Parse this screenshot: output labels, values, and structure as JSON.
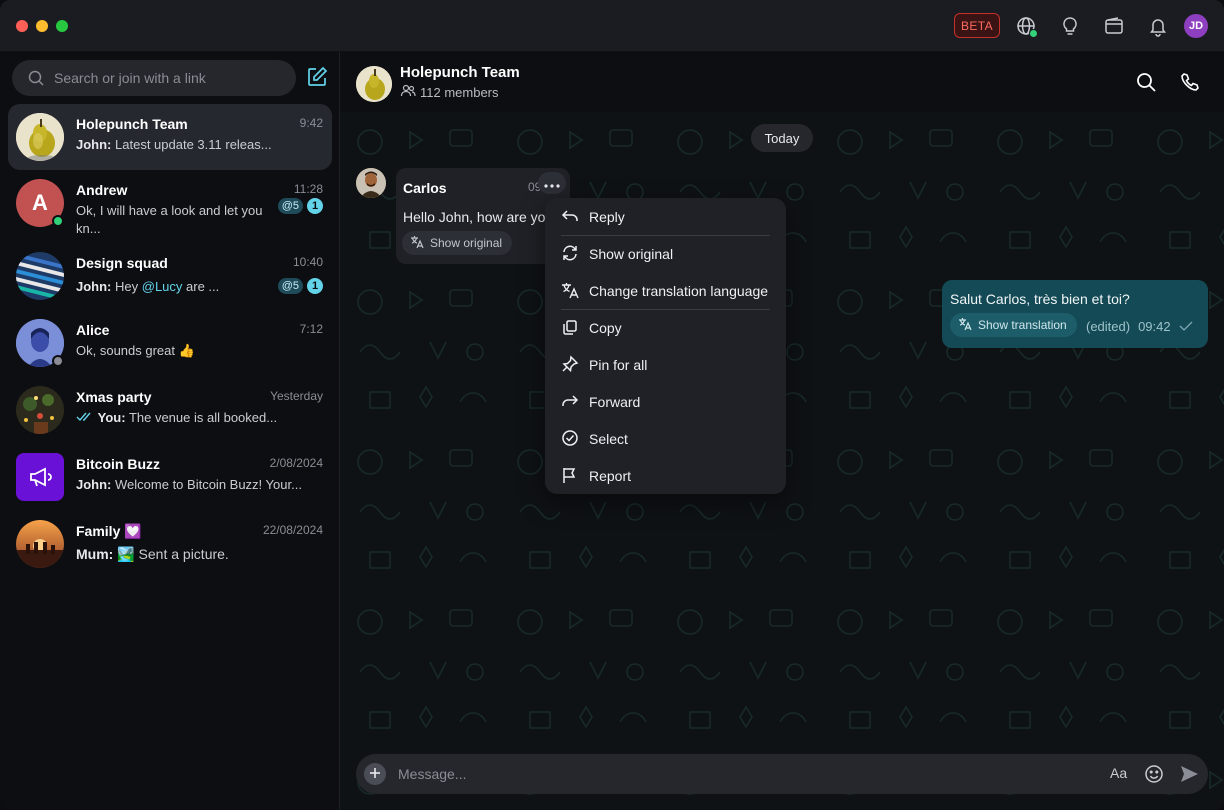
{
  "titlebar": {
    "beta_label": "BETA",
    "user_initials": "JD",
    "colors": {
      "close": "#ff5f57",
      "minimize": "#febc2e",
      "zoom": "#28c840"
    }
  },
  "sidebar": {
    "search_placeholder": "Search or join with a link",
    "chats": [
      {
        "name": "Holepunch Team",
        "time": "9:42",
        "sender": "John:",
        "preview": "Latest update 3.11 releas...",
        "active": true
      },
      {
        "name": "Andrew",
        "avatar_letter": "A",
        "time": "11:28",
        "preview": "Ok, I will have a look and let you kn...",
        "mentions": "@5",
        "unread": "1",
        "status": "online"
      },
      {
        "name": "Design squad",
        "time": "10:40",
        "sender": "John:",
        "preview_before": "Hey ",
        "preview_mention": "@Lucy",
        "preview_after": " are ...",
        "mentions": "@5",
        "unread": "1"
      },
      {
        "name": "Alice",
        "time": "7:12",
        "preview": "Ok, sounds great 👍",
        "status": "away"
      },
      {
        "name": "Xmas party",
        "time": "Yesterday",
        "sender": "You:",
        "preview": "The venue is all booked..."
      },
      {
        "name": "Bitcoin Buzz",
        "time": "2/08/2024",
        "sender": "John:",
        "preview": "Welcome to Bitcoin Buzz! Your..."
      },
      {
        "name": "Family 💟",
        "time": "22/08/2024",
        "sender": "Mum:",
        "preview": "🏞️ Sent a picture."
      }
    ]
  },
  "chat": {
    "title": "Holepunch Team",
    "members": "112 members",
    "day_label": "Today",
    "incoming": {
      "sender": "Carlos",
      "time": "09",
      "text": "Hello John, how are yo",
      "show_original": "Show original"
    },
    "outgoing": {
      "text": "Salut Carlos, très bien et toi?",
      "show_translation": "Show translation",
      "edited": "(edited)",
      "time": "09:42"
    },
    "composer_placeholder": "Message...",
    "format_label": "Aa"
  },
  "context_menu": {
    "items": [
      {
        "label": "Reply",
        "icon": "reply-icon"
      },
      {
        "label": "Show original",
        "icon": "refresh-icon"
      },
      {
        "label": "Change translation language",
        "icon": "translate-icon"
      },
      {
        "label": "Copy",
        "icon": "copy-icon"
      },
      {
        "label": "Pin for all",
        "icon": "pin-icon"
      },
      {
        "label": "Forward",
        "icon": "forward-icon"
      },
      {
        "label": "Select",
        "icon": "check-circle-icon"
      },
      {
        "label": "Report",
        "icon": "flag-icon"
      }
    ]
  },
  "colors": {
    "accent": "#63d3ea",
    "outgoing_bubble": "#134a55",
    "bitcoin_buzz": "#6a11d8",
    "andrew_avatar": "#c25252",
    "online": "#31d27a"
  }
}
